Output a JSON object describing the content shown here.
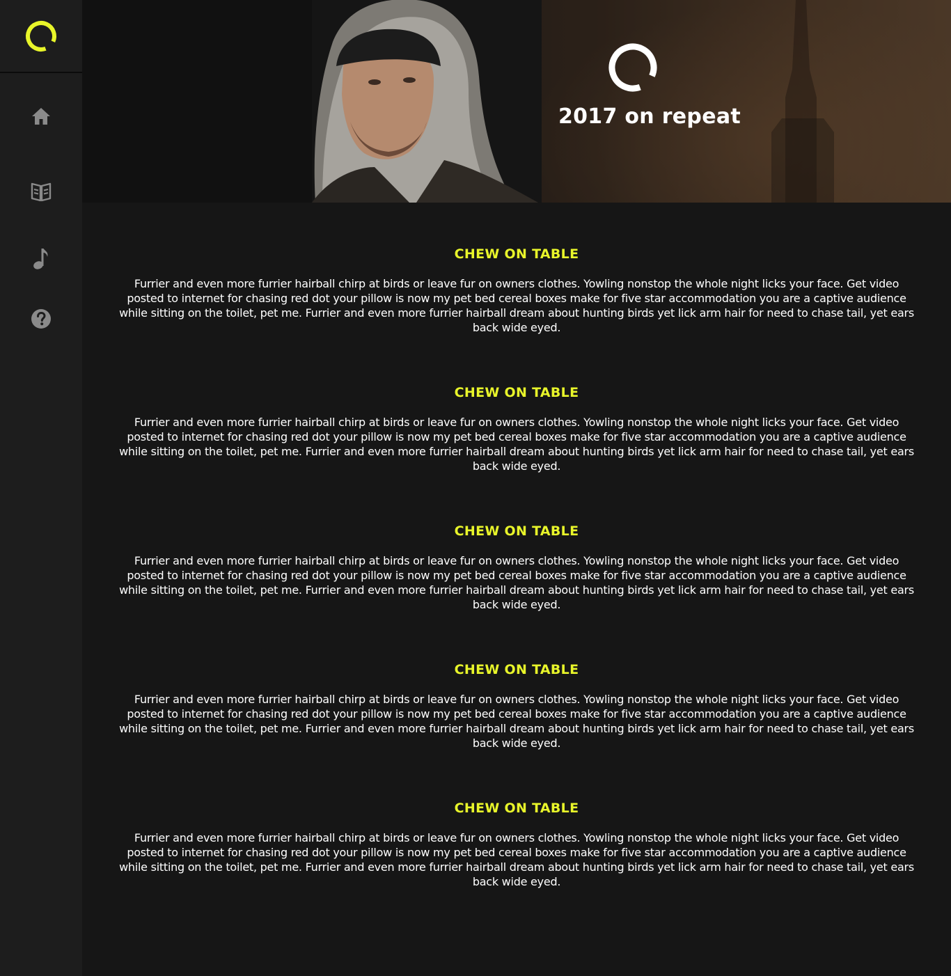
{
  "brand": {
    "accent_color": "#e8f52a",
    "logo_icon": "ring-logo-icon"
  },
  "sidebar": {
    "items": [
      {
        "name": "home",
        "icon": "home-icon"
      },
      {
        "name": "library",
        "icon": "book-icon"
      },
      {
        "name": "music",
        "icon": "music-note-icon"
      },
      {
        "name": "help",
        "icon": "help-icon"
      }
    ]
  },
  "hero": {
    "title": "2017 on repeat",
    "logo_icon": "ring-logo-icon"
  },
  "sections": [
    {
      "title": "CHEW ON TABLE",
      "text": "Furrier and even more furrier hairball chirp at birds or leave fur on owners clothes. Yowling nonstop the whole night licks your face. Get video posted to internet for chasing red dot your pillow is now my pet bed cereal boxes make for five star accommodation you are a captive audience while sitting on the toilet, pet me. Furrier and even more furrier hairball dream about hunting birds yet lick arm hair for need to chase tail, yet ears back wide eyed."
    },
    {
      "title": "CHEW ON TABLE",
      "text": "Furrier and even more furrier hairball chirp at birds or leave fur on owners clothes. Yowling nonstop the whole night licks your face. Get video posted to internet for chasing red dot your pillow is now my pet bed cereal boxes make for five star accommodation you are a captive audience while sitting on the toilet, pet me. Furrier and even more furrier hairball dream about hunting birds yet lick arm hair for need to chase tail, yet ears back wide eyed."
    },
    {
      "title": "CHEW ON TABLE",
      "text": "Furrier and even more furrier hairball chirp at birds or leave fur on owners clothes. Yowling nonstop the whole night licks your face. Get video posted to internet for chasing red dot your pillow is now my pet bed cereal boxes make for five star accommodation you are a captive audience while sitting on the toilet, pet me. Furrier and even more furrier hairball dream about hunting birds yet lick arm hair for need to chase tail, yet ears back wide eyed."
    },
    {
      "title": "CHEW ON TABLE",
      "text": "Furrier and even more furrier hairball chirp at birds or leave fur on owners clothes. Yowling nonstop the whole night licks your face. Get video posted to internet for chasing red dot your pillow is now my pet bed cereal boxes make for five star accommodation you are a captive audience while sitting on the toilet, pet me. Furrier and even more furrier hairball dream about hunting birds yet lick arm hair for need to chase tail, yet ears back wide eyed."
    },
    {
      "title": "CHEW ON TABLE",
      "text": "Furrier and even more furrier hairball chirp at birds or leave fur on owners clothes. Yowling nonstop the whole night licks your face. Get video posted to internet for chasing red dot your pillow is now my pet bed cereal boxes make for five star accommodation you are a captive audience while sitting on the toilet, pet me. Furrier and even more furrier hairball dream about hunting birds yet lick arm hair for need to chase tail, yet ears back wide eyed."
    }
  ]
}
